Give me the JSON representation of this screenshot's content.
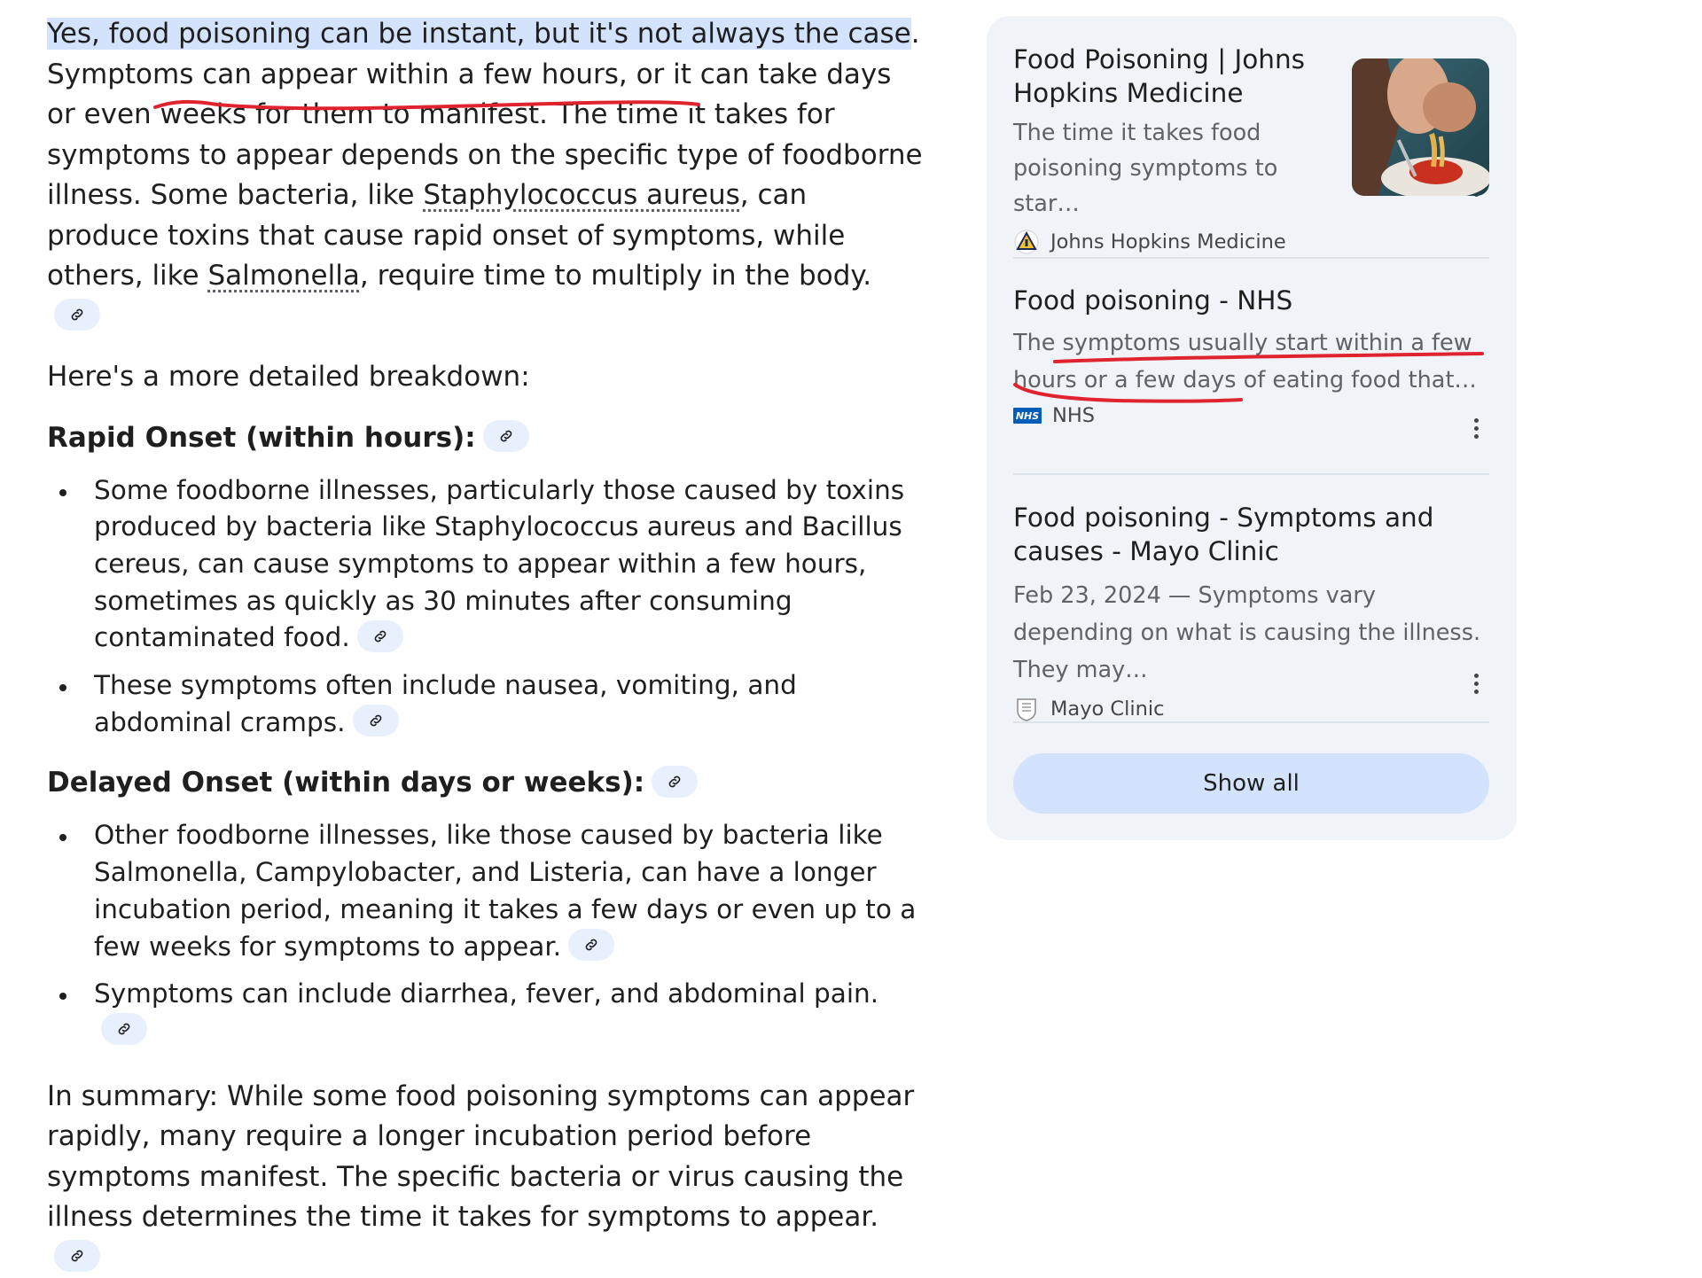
{
  "intro": {
    "highlight": "Yes, food poisoning can be instant, but it's not always the case",
    "rest_1": ". Symptoms can appear within a few hours, or it can take days or even weeks for them to manifest. The time it takes for symptoms to appear depends on the specific type of foodborne illness. Some bacteria, like ",
    "term_1": "Staphylococcus aureus",
    "rest_2": ", can produce toxins that cause rapid onset of symptoms, while others, like ",
    "term_2": "Salmonella",
    "rest_3": ", require time to multiply in the body."
  },
  "breakdown_intro": "Here's a more detailed breakdown:",
  "sections": [
    {
      "heading": "Rapid Onset (within hours):",
      "bullets": [
        "Some foodborne illnesses, particularly those caused by toxins produced by bacteria like Staphylococcus aureus and Bacillus cereus, can cause symptoms to appear within a few hours, sometimes as quickly as 30 minutes after consuming contaminated food.",
        "These symptoms often include nausea, vomiting, and abdominal cramps."
      ]
    },
    {
      "heading": "Delayed Onset (within days or weeks):",
      "bullets": [
        "Other foodborne illnesses, like those caused by bacteria like Salmonella, Campylobacter, and Listeria, can have a longer incubation period, meaning it takes a few days or even up to a few weeks for symptoms to appear.",
        "Symptoms can include diarrhea, fever, and abdominal pain."
      ]
    }
  ],
  "summary": "In summary: While some food poisoning symptoms can appear rapidly, many require a longer incubation period before symptoms manifest. The specific bacteria or virus causing the illness determines the time it takes for symptoms to appear.",
  "sources": [
    {
      "title": "Food Poisoning | Johns Hopkins Medicine",
      "snippet": "The time it takes food poisoning symptoms to star…",
      "source": "Johns Hopkins Medicine",
      "logo_text": "",
      "icon": "shield-logo-icon"
    },
    {
      "title": "Food poisoning - NHS",
      "snippet": "The symptoms usually start within a few hours or a few days of eating food that…",
      "source": "NHS",
      "logo_text": "NHS",
      "icon": "nhs-logo-icon"
    },
    {
      "title": "Food poisoning - Symptoms and causes - Mayo Clinic",
      "snippet": "Feb 23, 2024 — Symptoms vary depending on what is causing the illness. They may…",
      "source": "Mayo Clinic",
      "logo_text": "",
      "icon": "mayo-logo-icon"
    }
  ],
  "show_all": "Show all",
  "colors": {
    "highlight": "#d3e3fd",
    "chip": "#e8f0fe",
    "panel": "#f0f4f9",
    "button": "#d3e3fd",
    "annotation": "#e0242f",
    "nhs_blue": "#005eb8"
  }
}
